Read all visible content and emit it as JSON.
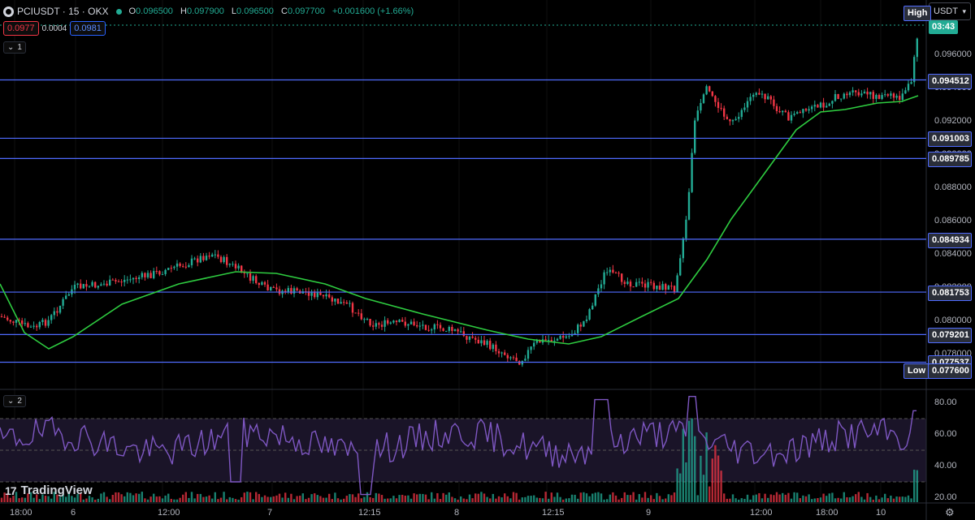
{
  "header": {
    "symbol": "PCIUSDT · 15 · OKX",
    "open_label": "O",
    "open": "0.096500",
    "high_label": "H",
    "high": "0.097900",
    "low_label": "L",
    "low": "0.096500",
    "close_label": "C",
    "close": "0.097700",
    "change": "+0.001600 (+1.66%)"
  },
  "order_panel": {
    "sell_price": "0.0977",
    "spread": "0.0004",
    "buy_price": "0.0981"
  },
  "panes": {
    "main_toggle": "1",
    "rsi_toggle": "2"
  },
  "currency_selector": {
    "value": "USDT"
  },
  "price_axis": {
    "labels": [
      "0.096000",
      "0.094000",
      "0.092000",
      "0.090000",
      "0.088000",
      "0.086000",
      "0.084000",
      "0.082000",
      "0.080000",
      "0.078000"
    ],
    "high_tag": "High",
    "countdown": "03:43",
    "low_tag": "Low",
    "low_value": "0.077600"
  },
  "levels": [
    "0.094512",
    "0.091003",
    "0.089785",
    "0.084934",
    "0.081753",
    "0.079201",
    "0.077537"
  ],
  "rsi_axis": [
    "80.00",
    "60.00",
    "40.00",
    "20.00"
  ],
  "time_axis": [
    "18:00",
    "6",
    "12:00",
    "7",
    "12:15",
    "8",
    "12:15",
    "9",
    "12:00",
    "18:00",
    "10"
  ],
  "watermark": {
    "brand": "TradingView"
  },
  "colors": {
    "up": "#22ab94",
    "down": "#f23645",
    "ma": "#2ecc40",
    "rsi": "#7e57c2",
    "level": "#4f6bff"
  }
}
